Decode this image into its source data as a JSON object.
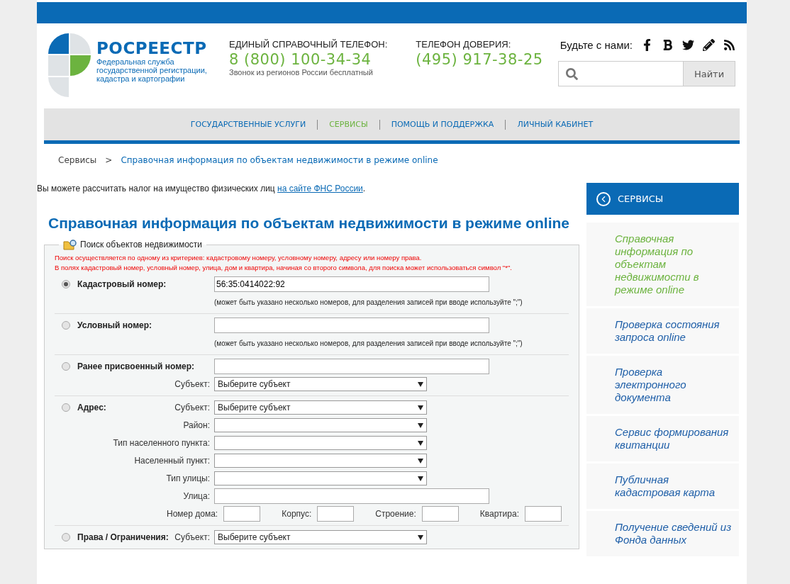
{
  "header": {
    "logo": {
      "name": "РОСРЕЕСТР",
      "subtitle_lines": [
        "Федеральная служба",
        "государственной регистрации,",
        "кадастра и картографии"
      ]
    },
    "phones": [
      {
        "title": "ЕДИНЫЙ СПРАВОЧНЫЙ ТЕЛЕФОН:",
        "number": "8 (800) 100-34-34",
        "note": "Звонок из регионов России бесплатный"
      },
      {
        "title": "ТЕЛЕФОН ДОВЕРИЯ:",
        "number": "(495) 917-38-25"
      }
    ],
    "social": {
      "label": "Будьте с нами:"
    },
    "search": {
      "button": "Найти"
    }
  },
  "nav": [
    {
      "label": "ГОСУДАРСТВЕННЫЕ УСЛУГИ",
      "selected": false
    },
    {
      "label": "СЕРВИСЫ",
      "selected": true
    },
    {
      "label": "ПОМОЩЬ И ПОДДЕРЖКА",
      "selected": false
    },
    {
      "label": "ЛИЧНЫЙ КАБИНЕТ",
      "selected": false
    }
  ],
  "breadcrumbs": {
    "separator": ">",
    "items": [
      "Сервисы",
      "Справочная информация по объектам недвижимости в режиме online"
    ]
  },
  "tax_note": {
    "text": "Вы можете рассчитать налог на имущество физических лиц",
    "link": "на сайте ФНС России",
    "end": "."
  },
  "title": "Справочная информация по объектам недвижимости в режиме online",
  "search_form": {
    "legend": "Поиск объектов недвижимости",
    "notes": [
      "Поиск осуществляется по одному из критериев: кадастровому номеру, условному номеру, адресу или номеру права.",
      "В полях кадастровый номер, условный номер, улица, дом и квартира, начиная со второго символа, для поиска может использоваться символ \"*\"."
    ],
    "criteria": [
      {
        "label": "Кадастровый номер:",
        "selected": true,
        "rows": [
          {
            "kind": "input",
            "value": "56:35:0414022:92"
          },
          {
            "kind": "hint",
            "text": "(может быть указано несколько номеров, для разделения записей при вводе используйте \";\")"
          }
        ]
      },
      {
        "label": "Условный номер:",
        "selected": false,
        "rows": [
          {
            "kind": "input"
          },
          {
            "kind": "hint",
            "text": "(может быть указано несколько номеров, для разделения записей при вводе используйте \";\")"
          }
        ]
      },
      {
        "label": "Ранее присвоенный номер:",
        "selected": false,
        "rows": [
          {
            "kind": "input"
          },
          {
            "kind": "select",
            "label": "Субъект:",
            "value": "Выберите субъект"
          }
        ]
      },
      {
        "label": "Адрес:",
        "selected": false,
        "rows": [
          {
            "kind": "select",
            "label": "Субъект:",
            "value": "Выберите субъект"
          },
          {
            "kind": "select",
            "label": "Район:"
          },
          {
            "kind": "select",
            "label": "Тип населенного пункта:"
          },
          {
            "kind": "select",
            "label": "Населенный пункт:"
          },
          {
            "kind": "select",
            "label": "Тип улицы:"
          },
          {
            "kind": "input",
            "label": "Улица:"
          },
          {
            "kind": "inline",
            "fields": [
              "Номер дома:",
              "Корпус:",
              "Строение:",
              "Квартира:"
            ]
          }
        ]
      },
      {
        "label": "Права / Ограничения:",
        "selected": false,
        "rows": [
          {
            "kind": "select",
            "label": "Субъект:",
            "value": "Выберите субъект"
          }
        ]
      }
    ]
  },
  "sidebar": {
    "title": "СЕРВИСЫ",
    "items": [
      {
        "label": "Справочная информация по объектам недвижимости в режиме online",
        "selected": true
      },
      {
        "label": "Проверка состояния запроса online",
        "selected": false
      },
      {
        "label": "Проверка электронного документа",
        "selected": false
      },
      {
        "label": "Сервис формирования квитанции",
        "selected": false
      },
      {
        "label": "Публичная кадастровая карта",
        "selected": false
      },
      {
        "label": "Получение сведений из Фонда данных",
        "selected": false
      }
    ]
  }
}
